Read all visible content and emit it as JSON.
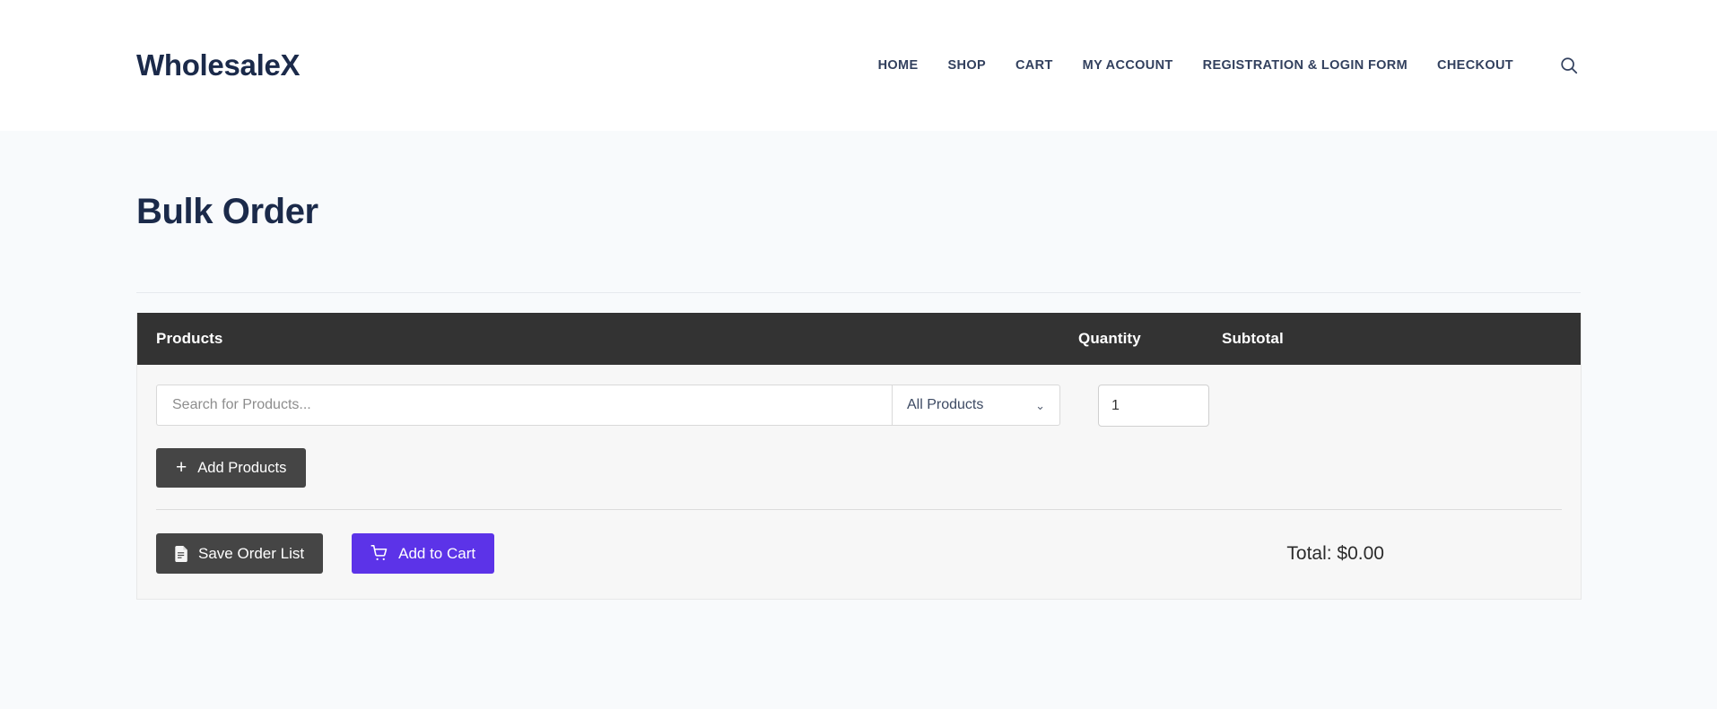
{
  "header": {
    "brand": "WholesaleX",
    "nav": [
      {
        "label": "HOME"
      },
      {
        "label": "SHOP"
      },
      {
        "label": "CART"
      },
      {
        "label": "MY ACCOUNT"
      },
      {
        "label": "REGISTRATION & LOGIN FORM"
      },
      {
        "label": "CHECKOUT"
      }
    ],
    "search_icon": "search-icon"
  },
  "page": {
    "title": "Bulk Order"
  },
  "bulk_order": {
    "columns": {
      "products": "Products",
      "quantity": "Quantity",
      "subtotal": "Subtotal"
    },
    "search": {
      "placeholder": "Search for Products...",
      "value": ""
    },
    "category": {
      "selected": "All Products",
      "chevron": "⌄"
    },
    "quantity": {
      "value": "1"
    },
    "add_products_label": "Add Products",
    "add_products_plus": "+",
    "save_order_label": "Save Order List",
    "add_to_cart_label": "Add to Cart",
    "total_label": "Total: $0.00"
  },
  "colors": {
    "brand_navy": "#1b2a4a",
    "panel_header": "#333333",
    "dark_button": "#454545",
    "accent_purple": "#5c33e8",
    "page_bg": "#f8fafc"
  }
}
